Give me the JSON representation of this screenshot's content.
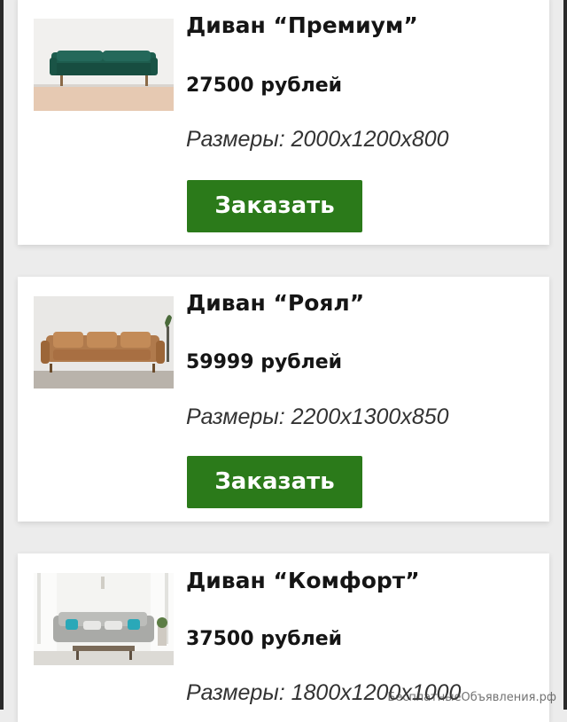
{
  "products": [
    {
      "title": "Диван “Премиум”",
      "price": "27500 рублей",
      "dimensions": "Размеры: 2000x1200x800",
      "button_label": "Заказать",
      "image": "green-sofa-photo"
    },
    {
      "title": "Диван “Роял”",
      "price": "59999 рублей",
      "dimensions": "Размеры: 2200x1300x850",
      "button_label": "Заказать",
      "image": "tan-leather-sofa-photo"
    },
    {
      "title": "Диван “Комфорт”",
      "price": "37500 рублей",
      "dimensions": "Размеры: 1800x1200x1000",
      "image": "grey-sofa-living-room-photo"
    }
  ],
  "watermark": "БесплатныеОбъявления.рф",
  "colors": {
    "button": "#2b7a1a",
    "background": "#ececec",
    "card": "#ffffff"
  }
}
